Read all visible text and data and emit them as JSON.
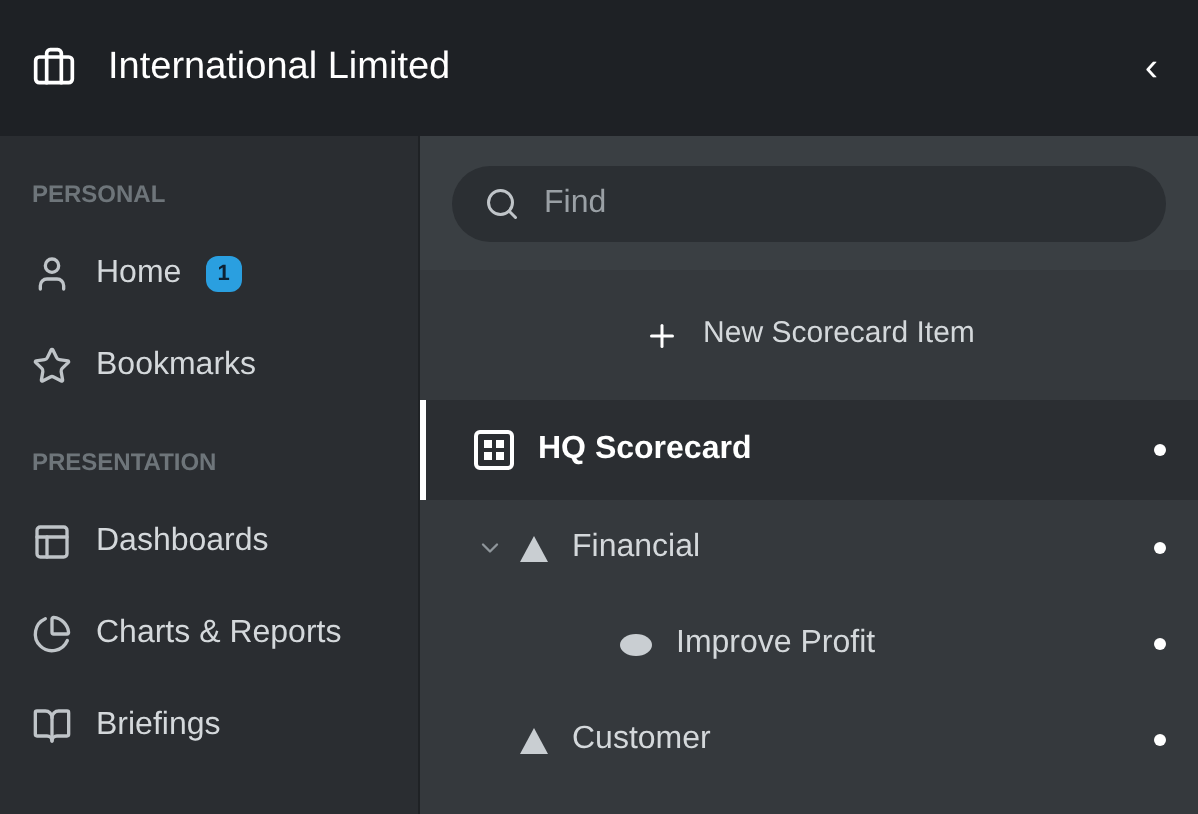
{
  "header": {
    "title": "International Limited",
    "collapse": "‹"
  },
  "sidebar": {
    "sections": [
      {
        "title": "PERSONAL",
        "items": [
          {
            "label": "Home",
            "badge": "1"
          },
          {
            "label": "Bookmarks"
          }
        ]
      },
      {
        "title": "PRESENTATION",
        "items": [
          {
            "label": "Dashboards"
          },
          {
            "label": "Charts & Reports"
          },
          {
            "label": "Briefings"
          }
        ]
      }
    ]
  },
  "search": {
    "placeholder": "Find"
  },
  "new_item": {
    "label": "New Scorecard Item"
  },
  "scorecard": {
    "label": "HQ Scorecard",
    "selected": true
  },
  "tree": [
    {
      "label": "Financial",
      "kind": "perspective",
      "expanded": true,
      "children": [
        {
          "label": "Improve Profit",
          "kind": "objective"
        }
      ]
    },
    {
      "label": "Customer",
      "kind": "perspective"
    }
  ]
}
